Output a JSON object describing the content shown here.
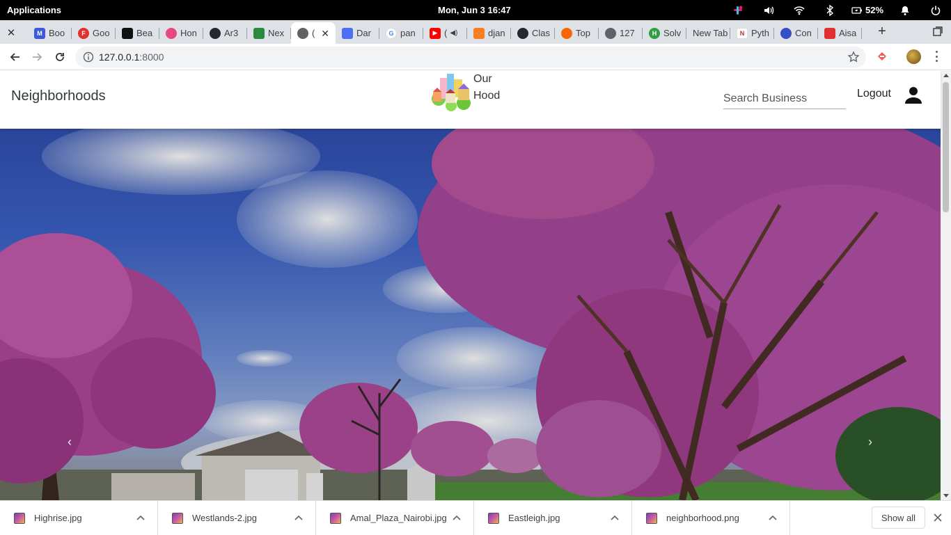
{
  "topbar": {
    "applications": "Applications",
    "clock": "Mon, Jun  3   16:47",
    "battery": "52%"
  },
  "tabs": [
    {
      "label": "Boo",
      "icon": "mdb-icon",
      "color": "#3b5bdb"
    },
    {
      "label": "Goo",
      "icon": "f-icon",
      "color": "#e03131"
    },
    {
      "label": "Bea",
      "icon": "bea-icon",
      "color": "#111111"
    },
    {
      "label": "Hon",
      "icon": "hon-icon",
      "color": "#e64980"
    },
    {
      "label": "Ar3",
      "icon": "github-icon",
      "color": "#24292e"
    },
    {
      "label": "Nex",
      "icon": "nex-icon",
      "color": "#2b8a3e"
    },
    {
      "label": "(",
      "icon": "globe-icon",
      "color": "#5f6368",
      "active": true
    },
    {
      "label": "Dar",
      "icon": "dar-icon",
      "color": "#4c6ef5"
    },
    {
      "label": "pan",
      "icon": "google-icon",
      "color": "#4285f4"
    },
    {
      "label": "(",
      "icon": "youtube-icon",
      "color": "#ff0000"
    },
    {
      "label": "djan",
      "icon": "so-icon",
      "color": "#f48024"
    },
    {
      "label": "Clas",
      "icon": "github-icon",
      "color": "#24292e"
    },
    {
      "label": "Top",
      "icon": "top-icon",
      "color": "#f76707"
    },
    {
      "label": "127",
      "icon": "globe-icon",
      "color": "#5f6368"
    },
    {
      "label": "Solv",
      "icon": "h-icon",
      "color": "#2f9e44"
    },
    {
      "label": "New Tab",
      "icon": "",
      "color": ""
    },
    {
      "label": "Pyth",
      "icon": "pyth-icon",
      "color": "#c92a2a"
    },
    {
      "label": "Con",
      "icon": "con-icon",
      "color": "#364fc7"
    },
    {
      "label": "Aisa",
      "icon": "aisa-icon",
      "color": "#e03131"
    }
  ],
  "omnibox": {
    "host": "127.0.0.1",
    "port": ":8000"
  },
  "site": {
    "brand": "Neighborhoods",
    "logo_line1": "Our",
    "logo_line2": "Hood",
    "search_placeholder": "Search Business",
    "logout": "Logout",
    "prev_arrow": "‹",
    "next_arrow": "›"
  },
  "downloads": [
    {
      "name": "Highrise.jpg"
    },
    {
      "name": "Westlands-2.jpg"
    },
    {
      "name": "Amal_Plaza_Nairobi.jpg"
    },
    {
      "name": "Eastleigh.jpg"
    },
    {
      "name": "neighborhood.png"
    }
  ],
  "shelf": {
    "show_all": "Show all"
  }
}
